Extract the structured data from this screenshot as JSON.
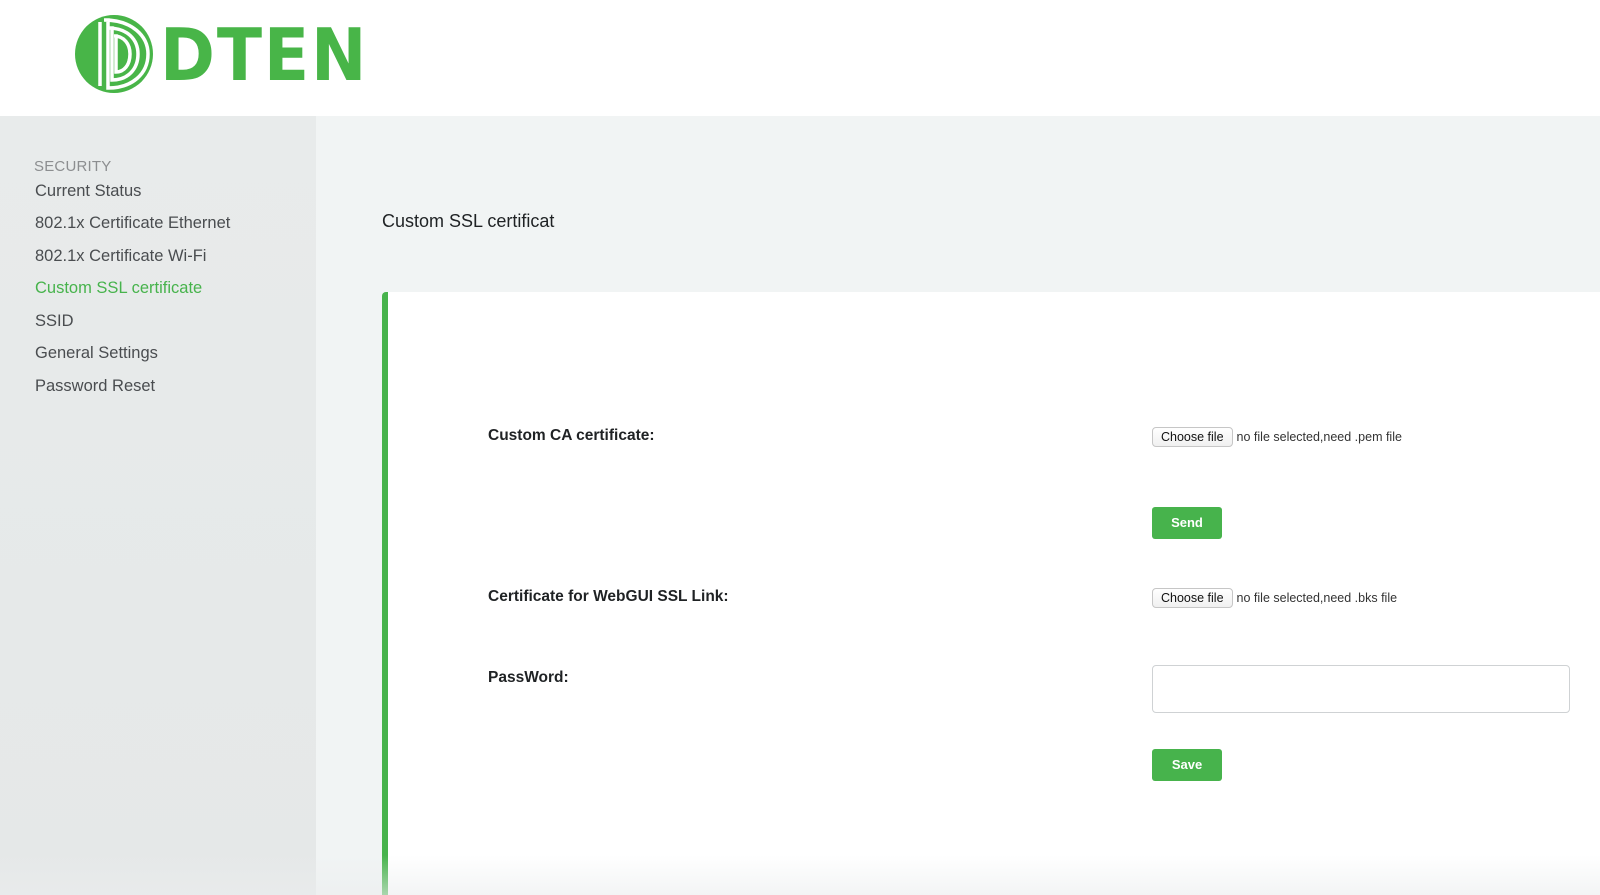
{
  "brand": {
    "name": "DTEN",
    "color": "#48b548"
  },
  "sidebar": {
    "heading": "SECURITY",
    "items": [
      {
        "label": "Current Status",
        "active": false
      },
      {
        "label": "802.1x Certificate Ethernet",
        "active": false
      },
      {
        "label": "802.1x Certificate Wi-Fi",
        "active": false
      },
      {
        "label": "Custom SSL certificate",
        "active": true
      },
      {
        "label": "SSID",
        "active": false
      },
      {
        "label": "General Settings",
        "active": false
      },
      {
        "label": "Password Reset",
        "active": false
      }
    ]
  },
  "main": {
    "title": "Custom SSL certificat",
    "ca_certificate": {
      "label": "Custom CA certificate:",
      "choose_label": "Choose file",
      "file_status": "no file selected,need .pem file"
    },
    "send_label": "Send",
    "webgui_certificate": {
      "label": "Certificate for WebGUI SSL Link:",
      "choose_label": "Choose file",
      "file_status": "no file selected,need .bks file"
    },
    "password": {
      "label": "PassWord:",
      "value": ""
    },
    "save_label": "Save"
  },
  "colors": {
    "accent": "#47b34c",
    "sidebar_bg": "#e7eaea",
    "main_bg": "#f1f4f4"
  }
}
